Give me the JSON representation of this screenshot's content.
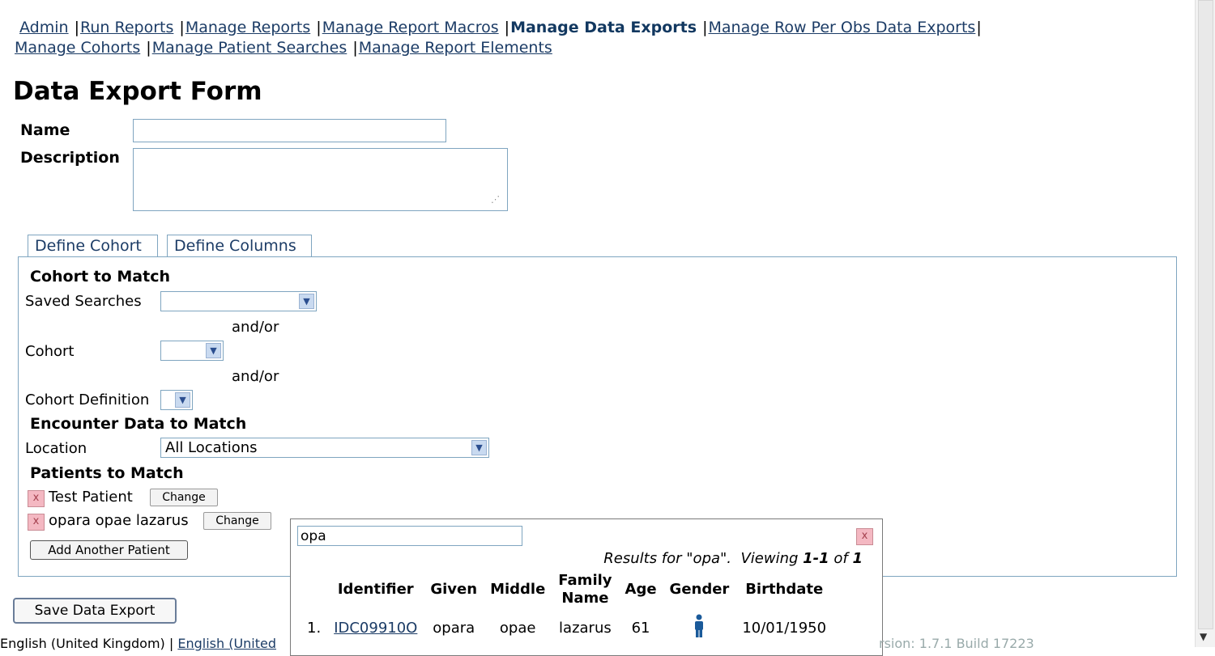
{
  "nav": {
    "admin": "Admin",
    "run_reports": "Run Reports",
    "manage_reports": "Manage Reports",
    "manage_report_macros": "Manage Report Macros",
    "manage_data_exports": "Manage Data Exports",
    "manage_row_per_obs": "Manage Row Per Obs Data Exports",
    "manage_cohorts": "Manage Cohorts",
    "manage_patient_searches": "Manage Patient Searches",
    "manage_report_elements": "Manage Report Elements",
    "sep": "|"
  },
  "page_title": "Data Export Form",
  "form": {
    "name_label": "Name",
    "name_value": "",
    "description_label": "Description",
    "description_value": ""
  },
  "tabs": [
    "Define Cohort",
    "Define Columns"
  ],
  "cohort": {
    "section_title": "Cohort to Match",
    "saved_searches_label": "Saved Searches",
    "saved_searches_value": "",
    "andor": "and/or",
    "cohort_label": "Cohort",
    "cohort_value": "",
    "cohort_def_label": "Cohort Definition",
    "cohort_def_value": "",
    "encounter_title": "Encounter Data to Match",
    "location_label": "Location",
    "location_value": "All Locations",
    "patients_title": "Patients to Match",
    "patients": [
      {
        "name": "Test Patient",
        "remove": "x",
        "change": "Change"
      },
      {
        "name": "opara opae lazarus",
        "remove": "x",
        "change": "Change"
      }
    ],
    "add_patient": "Add Another Patient"
  },
  "save_button": "Save Data Export",
  "search_popup": {
    "query": "opa",
    "close": "x",
    "results_prefix": "Results for \"opa\".  Viewing ",
    "results_range": "1-1",
    "results_of": " of ",
    "results_total": "1",
    "columns": [
      "",
      "Identifier",
      "Given",
      "Middle",
      "Family Name",
      "Age",
      "Gender",
      "Birthdate"
    ],
    "rows": [
      {
        "index": "1.",
        "identifier": "IDC09910O",
        "given": "opara",
        "middle": "opae",
        "family": "lazarus",
        "age": "61",
        "gender_icon": "male-person-icon",
        "birthdate": "10/01/1950"
      }
    ]
  },
  "footer": {
    "locale_current": "English (United Kingdom)",
    "sep": "|",
    "locale_link": "English (United",
    "version": "rsion: 1.7.1 Build 17223"
  },
  "colors": {
    "link": "#1c3c66",
    "border": "#7fa5c0",
    "remove_bg": "#f4b8c2"
  }
}
